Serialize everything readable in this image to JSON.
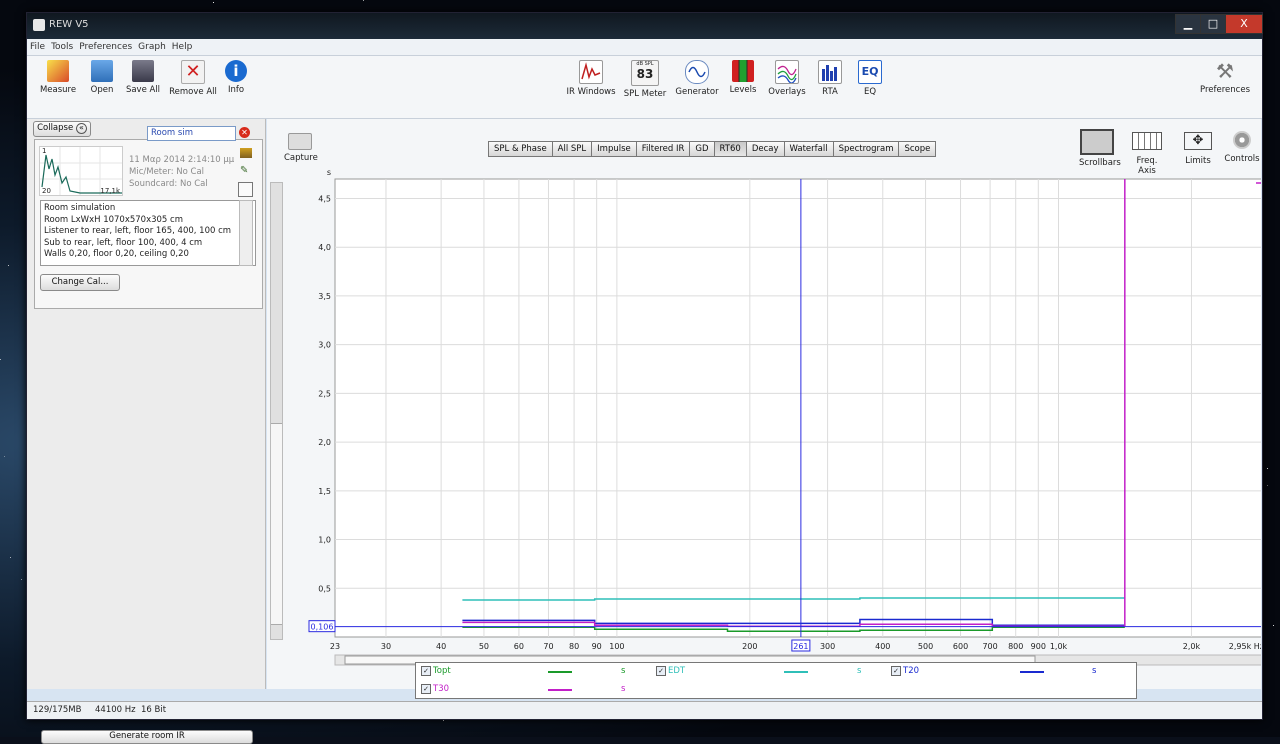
{
  "window": {
    "title": "REW V5",
    "controls": {
      "minimize": "▁",
      "maximize": "□",
      "close": "X"
    }
  },
  "menu": [
    "File",
    "Tools",
    "Preferences",
    "Graph",
    "Help"
  ],
  "toolbar_left": [
    {
      "label": "Measure",
      "icon": "measure-icon"
    },
    {
      "label": "Open",
      "icon": "folder-icon"
    },
    {
      "label": "Save All",
      "icon": "save-icon"
    },
    {
      "label": "Remove All",
      "icon": "remove-icon"
    },
    {
      "label": "Info",
      "icon": "info-icon"
    }
  ],
  "toolbar_center": [
    {
      "label": "IR Windows",
      "icon": "ir-windows-icon"
    },
    {
      "label": "SPL Meter",
      "icon": "spl-meter-icon",
      "reading": "83",
      "caption": "dB SPL"
    },
    {
      "label": "Generator",
      "icon": "generator-icon"
    },
    {
      "label": "Levels",
      "icon": "levels-icon"
    },
    {
      "label": "Overlays",
      "icon": "overlays-icon"
    },
    {
      "label": "RTA",
      "icon": "rta-icon"
    },
    {
      "label": "EQ",
      "icon": "eq-icon",
      "badge": "EQ"
    }
  ],
  "preferences_label": "Preferences",
  "left": {
    "collapse_label": "Collapse",
    "collapse_glyph": "«",
    "measurement_name": "Room sim",
    "date": "11 Μαρ 2014 2:14:10 μμ",
    "mic": "Mic/Meter: No Cal",
    "soundcard": "Soundcard: No Cal",
    "thumb_labels": {
      "top": "1",
      "left": "20",
      "right": "17,1k"
    },
    "notes": [
      "Room simulation",
      "Room LxWxH 1070x570x305 cm",
      "Listener to rear, left, floor 165, 400, 100 cm",
      "Sub to rear, left, floor 100, 400, 4 cm",
      "Walls 0,20, floor 0,20, ceiling 0,20"
    ],
    "change_cal_label": "Change Cal...",
    "generate_label": "Generate room IR"
  },
  "capture_label": "Capture",
  "tabs": [
    "SPL & Phase",
    "All SPL",
    "Impulse",
    "Filtered IR",
    "GD",
    "RT60",
    "Decay",
    "Waterfall",
    "Spectrogram",
    "Scope"
  ],
  "active_tab": "RT60",
  "right_controls": [
    "Scrollbars",
    "Freq. Axis",
    "Limits",
    "Controls"
  ],
  "y_unit": "s",
  "cursor_readout": {
    "y": "0,106",
    "x": "261"
  },
  "x_unit_label": "2,95k Hz",
  "legend": [
    {
      "name": "Topt",
      "unit": "s",
      "color": "#1a9a2a"
    },
    {
      "name": "EDT",
      "unit": "s",
      "color": "#2fbfb8"
    },
    {
      "name": "T20",
      "unit": "s",
      "color": "#1a2ad0"
    },
    {
      "name": "T30",
      "unit": "s",
      "color": "#c21fc8"
    }
  ],
  "status": {
    "memory": "129/175MB",
    "rate": "44100 Hz",
    "bits": "16 Bit"
  },
  "chart_data": {
    "type": "line",
    "xscale": "log",
    "xlim": [
      23,
      2950
    ],
    "ylim": [
      0,
      4.7
    ],
    "y_ticks": [
      "0,5",
      "1,0",
      "1,5",
      "2,0",
      "2,5",
      "3,0",
      "3,5",
      "4,0",
      "4,5"
    ],
    "y_tick_values": [
      0.5,
      1.0,
      1.5,
      2.0,
      2.5,
      3.0,
      3.5,
      4.0,
      4.5
    ],
    "x_ticks": [
      "23",
      "30",
      "40",
      "50",
      "60",
      "70",
      "80",
      "90",
      "100",
      "200",
      "300",
      "400",
      "500",
      "600",
      "700",
      "800",
      "900",
      "1,0k",
      "2,0k"
    ],
    "x_tick_values": [
      23,
      30,
      40,
      50,
      60,
      70,
      80,
      90,
      100,
      200,
      300,
      400,
      500,
      600,
      700,
      800,
      900,
      1000,
      2000
    ],
    "x_cursor": 261,
    "y_cursor": 0.106,
    "band_edges": [
      44.7,
      89.1,
      178,
      355,
      708,
      1413
    ],
    "series": [
      {
        "name": "Topt",
        "color": "#1a9a2a",
        "values": [
          0.1,
          0.08,
          0.06,
          0.07,
          0.1
        ]
      },
      {
        "name": "EDT",
        "color": "#2fbfb8",
        "values": [
          0.38,
          0.39,
          0.39,
          0.4,
          0.4
        ]
      },
      {
        "name": "T20",
        "color": "#1a2ad0",
        "values": [
          0.17,
          0.14,
          0.14,
          0.18,
          0.12
        ]
      },
      {
        "name": "T30",
        "color": "#c21fc8",
        "values": [
          0.15,
          0.12,
          0.11,
          0.13,
          0.11
        ]
      }
    ]
  }
}
